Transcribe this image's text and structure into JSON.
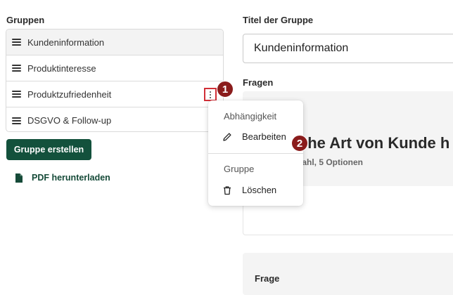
{
  "left": {
    "groups_title": "Gruppen",
    "groups": [
      {
        "label": "Kundeninformation"
      },
      {
        "label": "Produktinteresse"
      },
      {
        "label": "Produktzufriedenheit"
      },
      {
        "label": "DSGVO & Follow-up"
      }
    ],
    "create_button": "Gruppe erstellen",
    "pdf_link": "PDF herunterladen"
  },
  "right": {
    "title_label": "Titel der Gruppe",
    "title_value": "Kundeninformation",
    "questions_label": "Fragen",
    "question_heading": "che Art von Kunde h",
    "question_meta": "wahl, 5 Optionen",
    "frage_label": "Frage"
  },
  "menu": {
    "section_dependency": "Abhängigkeit",
    "edit": "Bearbeiten",
    "section_group": "Gruppe",
    "delete": "Löschen"
  },
  "badges": {
    "step1": "1",
    "step2": "2"
  },
  "colors": {
    "primary_green": "#13513c",
    "badge_red": "#8a1c1c",
    "highlight_red": "#d12f37"
  }
}
